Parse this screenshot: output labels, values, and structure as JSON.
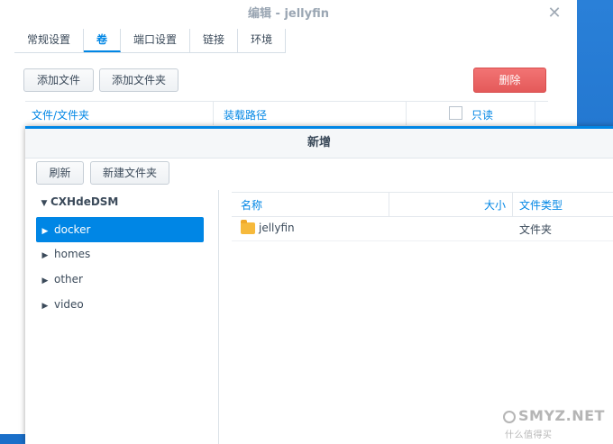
{
  "back_window": {
    "title": "编辑 - jellyfin",
    "close_glyph": "✕",
    "tabs": [
      {
        "label": "常规设置",
        "active": false
      },
      {
        "label": "卷",
        "active": true
      },
      {
        "label": "端口设置",
        "active": false
      },
      {
        "label": "链接",
        "active": false
      },
      {
        "label": "环境",
        "active": false
      }
    ],
    "add_file_label": "添加文件",
    "add_folder_label": "添加文件夹",
    "delete_label": "删除",
    "columns": {
      "path": "文件/文件夹",
      "mount": "装载路径",
      "readonly": "只读"
    }
  },
  "dialog": {
    "title": "新增",
    "refresh_label": "刷新",
    "new_folder_label": "新建文件夹",
    "tree": {
      "root": "CXHdeDSM",
      "items": [
        {
          "label": "docker",
          "selected": true
        },
        {
          "label": "homes",
          "selected": false
        },
        {
          "label": "other",
          "selected": false
        },
        {
          "label": "video",
          "selected": false
        }
      ]
    },
    "grid": {
      "columns": {
        "name": "名称",
        "size": "大小",
        "type": "文件类型"
      },
      "rows": [
        {
          "name": "jellyfin",
          "size": "",
          "type": "文件夹",
          "icon": "folder-icon"
        }
      ]
    }
  },
  "watermark": {
    "text": "SMYZ.NET",
    "sub": "什么值得买"
  },
  "colors": {
    "accent": "#0086e5",
    "danger": "#e45a5a",
    "folder": "#f6b93b"
  }
}
